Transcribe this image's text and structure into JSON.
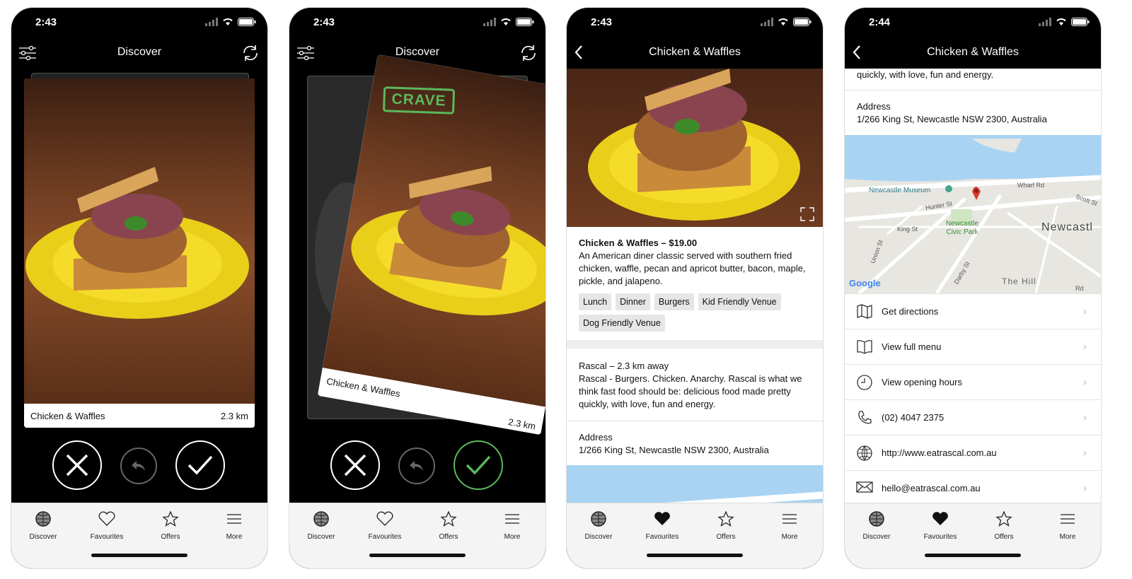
{
  "status_times": [
    "2:43",
    "2:43",
    "2:43",
    "2:44"
  ],
  "nav": {
    "discover_title": "Discover",
    "detail_title": "Chicken & Waffles"
  },
  "card": {
    "name": "Chicken & Waffles",
    "distance": "2.3 km",
    "crave_label": "CRAVE"
  },
  "dish": {
    "heading": "Chicken & Waffles – $19.00",
    "description": "An American diner classic served with southern fried chicken, waffle, pecan and apricot butter, bacon, maple, pickle, and jalapeno.",
    "tags": [
      "Lunch",
      "Dinner",
      "Burgers",
      "Kid Friendly Venue",
      "Dog Friendly Venue"
    ]
  },
  "venue": {
    "heading": "Rascal – 2.3 km away",
    "description": "Rascal - Burgers. Chicken. Anarchy. Rascal is what we think fast food should be: delicious food made pretty quickly, with love, fun and energy.",
    "description_tail": "quickly, with love, fun and energy.",
    "address_label": "Address",
    "address": "1/266 King St, Newcastle NSW 2300, Australia"
  },
  "map": {
    "labels": {
      "museum": "Newcastle Museum",
      "hunter": "Hunter St",
      "wharf": "Wharf Rd",
      "scott": "Scott St",
      "king": "King St",
      "civic": "Newcastle Civic Park",
      "city": "Newcastl",
      "union": "Union St",
      "darby": "Darby St",
      "hill": "The Hill",
      "google": "Google",
      "rd": "Rd"
    }
  },
  "actions": [
    {
      "label": "Get directions",
      "icon": "map-icon"
    },
    {
      "label": "View full menu",
      "icon": "book-icon"
    },
    {
      "label": "View opening hours",
      "icon": "clock-icon"
    },
    {
      "label": "(02) 4047 2375",
      "icon": "phone-icon"
    },
    {
      "label": "http://www.eatrascal.com.au",
      "icon": "globe-icon"
    },
    {
      "label": "hello@eatrascal.com.au",
      "icon": "mail-icon"
    }
  ],
  "tabs": [
    {
      "label": "Discover",
      "icon": "globe-icon"
    },
    {
      "label": "Favourites",
      "icon": "heart-icon"
    },
    {
      "label": "Offers",
      "icon": "star-icon"
    },
    {
      "label": "More",
      "icon": "menu-icon"
    }
  ],
  "colors": {
    "crave_green": "#5cb85c",
    "plate_yellow": "#f2d400",
    "map_water": "#a9d3f2",
    "pin_red": "#d93a2b"
  }
}
